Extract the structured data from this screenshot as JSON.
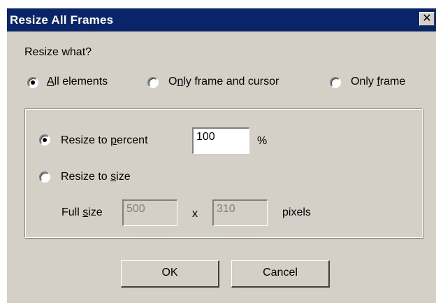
{
  "window": {
    "title": "Resize All Frames",
    "close_glyph": "✕"
  },
  "resize_what": {
    "label": "Resize what?",
    "options": [
      {
        "label_prefix": "",
        "accel": "A",
        "label_rest": "ll elements",
        "checked": true
      },
      {
        "label_prefix": "O",
        "accel": "n",
        "label_rest": "ly frame and cursor",
        "checked": false
      },
      {
        "label_prefix": "Only ",
        "accel": "f",
        "label_rest": "rame",
        "checked": false
      }
    ]
  },
  "resize_mode": {
    "percent": {
      "label_prefix": "Resize to ",
      "accel": "p",
      "label_rest": "ercent",
      "checked": true,
      "value": "100",
      "unit": "%"
    },
    "size": {
      "label_prefix": "Resize to ",
      "accel": "s",
      "label_rest": "ize",
      "checked": false
    },
    "full_size": {
      "label_prefix": "Full ",
      "accel": "s",
      "label_rest": "ize",
      "width": "500",
      "separator": "x",
      "height": "310",
      "unit": "pixels"
    }
  },
  "buttons": {
    "ok": "OK",
    "cancel": "Cancel"
  }
}
